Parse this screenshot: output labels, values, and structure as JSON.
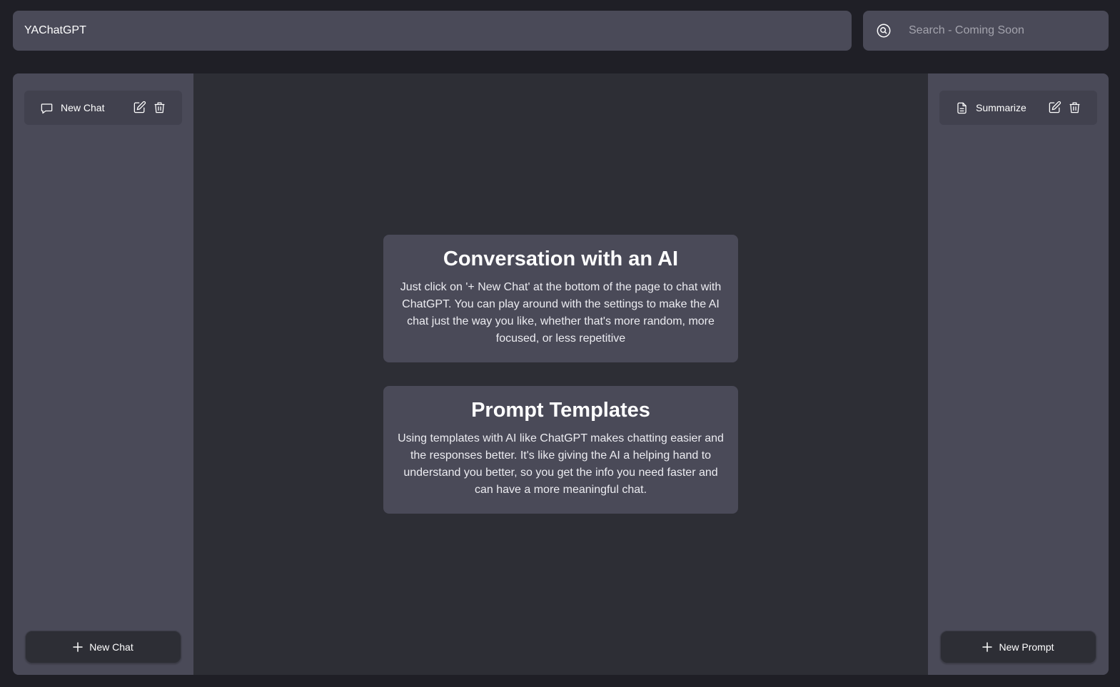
{
  "app": {
    "title": "YAChatGPT"
  },
  "search": {
    "placeholder": "Search - Coming Soon",
    "icon": "search-icon"
  },
  "chats": {
    "items": [
      {
        "label": "New Chat",
        "icon": "chat-bubble-icon"
      }
    ],
    "new_button": "New Chat"
  },
  "prompts": {
    "items": [
      {
        "label": "Summarize",
        "icon": "document-icon"
      }
    ],
    "new_button": "New Prompt"
  },
  "main": {
    "cards": [
      {
        "title": "Conversation with an AI",
        "body": "Just click on '+ New Chat' at the bottom of the page to chat with ChatGPT. You can play around with the settings to make the AI chat just the way you like, whether that's more random, more focused, or less repetitive"
      },
      {
        "title": "Prompt Templates",
        "body": "Using templates with AI like ChatGPT makes chatting easier and the responses better. It's like giving the AI a helping hand to understand you better, so you get the info you need faster and can have a more meaningful chat."
      }
    ]
  },
  "colors": {
    "background": "#1f1f26",
    "panel": "#4a4a58",
    "main_area": "#2d2e35",
    "text": "#ececf1"
  }
}
